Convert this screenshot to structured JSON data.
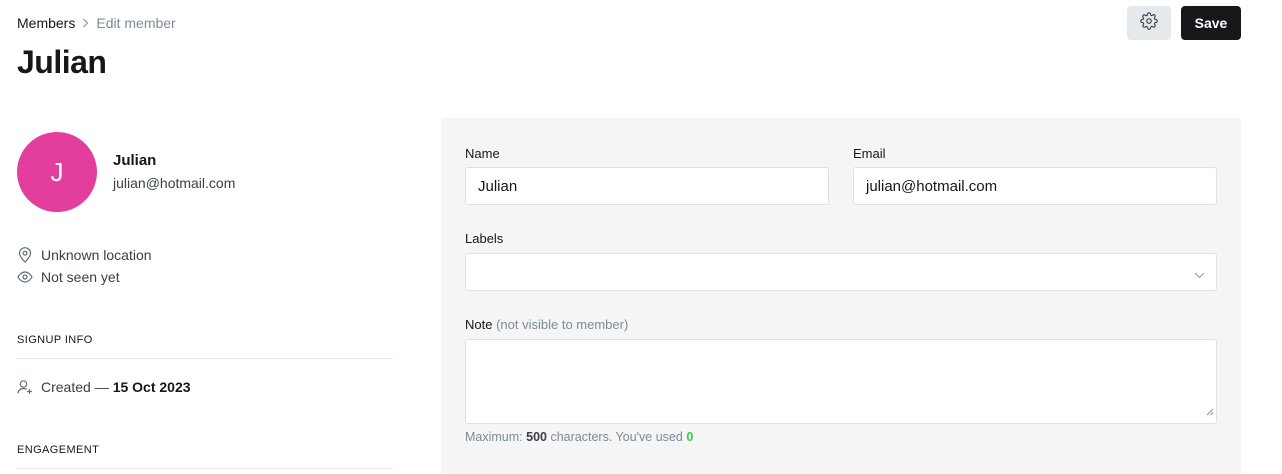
{
  "breadcrumb": {
    "parent": "Members",
    "current": "Edit member"
  },
  "page": {
    "title": "Julian"
  },
  "toolbar": {
    "save_label": "Save",
    "settings_icon": "gear-icon"
  },
  "member": {
    "initial": "J",
    "name": "Julian",
    "email": "julian@hotmail.com",
    "avatar_color": "#e33d9e",
    "location": "Unknown location",
    "last_seen": "Not seen yet"
  },
  "signup_info": {
    "heading": "SIGNUP INFO",
    "created_label": "Created —",
    "created_date": "15 Oct 2023"
  },
  "engagement": {
    "heading": "ENGAGEMENT"
  },
  "form": {
    "name_label": "Name",
    "name_value": "Julian",
    "email_label": "Email",
    "email_value": "julian@hotmail.com",
    "labels_label": "Labels",
    "labels_value": "",
    "note_label": "Note",
    "note_hint": "(not visible to member)",
    "note_value": "",
    "counter_prefix": "Maximum:",
    "counter_max": "500",
    "counter_middle": "characters. You've used",
    "counter_used": "0"
  },
  "colors": {
    "accent_used": "#30cf43",
    "save_bg": "#15171a",
    "panel_bg": "#f4f5f4"
  }
}
